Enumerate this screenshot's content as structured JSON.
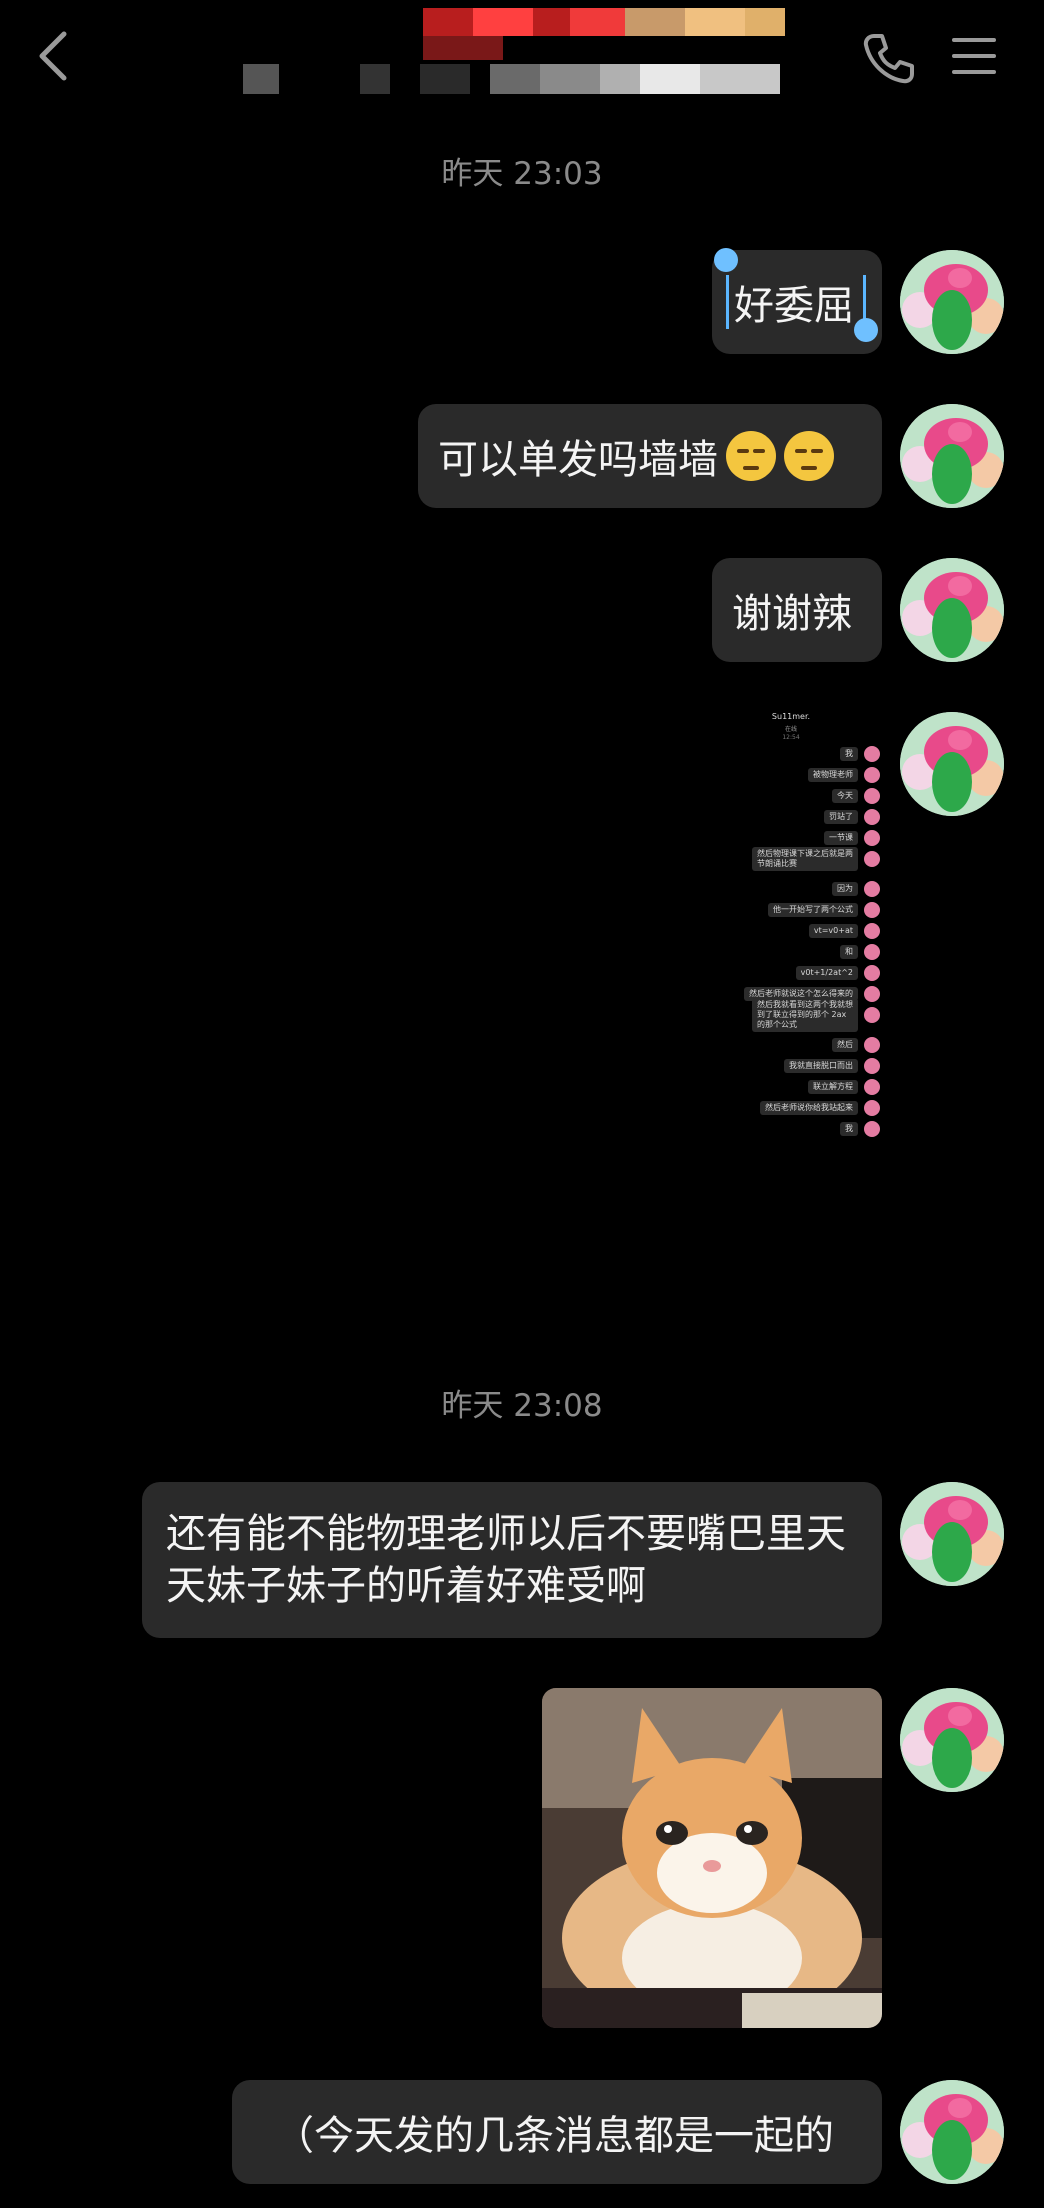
{
  "header": {
    "back_icon": "chevron-left-icon",
    "call_icon": "phone-icon",
    "menu_icon": "hamburger-menu-icon"
  },
  "chat": {
    "timestamp_1": "昨天 23:03",
    "msg_1": "好委屈",
    "msg_2": "可以单发吗墙墙",
    "msg_3": "谢谢辣",
    "timestamp_2": "昨天 23:08",
    "msg_4": "还有能不能物理老师以后不要嘴巴里天天妹子妹子的听着好难受啊",
    "msg_5": "（今天发的几条消息都是一起的"
  },
  "embedded_screenshot": {
    "title": "Su11mer.",
    "subtitle": "在线",
    "time": "12:54",
    "messages": [
      "我",
      "被物理老师",
      "今天",
      "罚站了",
      "一节课",
      "然后物理课下课之后就是两节朗诵比赛",
      "因为",
      "他一开始写了两个公式",
      "vt=v0+at",
      "和",
      "v0t+1/2at^2",
      "然后老师就说这个怎么得来的",
      "然后我就看到这两个我就想到了联立得到的那个 2ax 的那个公式",
      "然后",
      "我就直接脱口而出",
      "联立解方程",
      "然后老师说你给我站起来",
      "我"
    ]
  },
  "images": {
    "cat_photo": "crying-cat-meme"
  },
  "colors": {
    "background": "#000000",
    "bubble": "#2a2a2a",
    "selection": "#5bb6ff"
  }
}
